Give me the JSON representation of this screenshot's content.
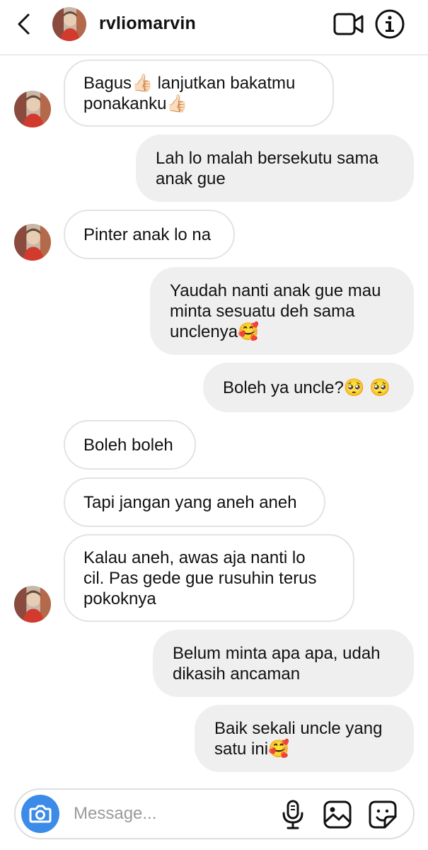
{
  "header": {
    "username": "rvliomarvin",
    "icons": {
      "back": "chevron-left-icon",
      "video": "video-call-icon",
      "info": "info-icon"
    }
  },
  "messages": [
    {
      "direction": "received",
      "text": "Bagus👍🏻 lanjutkan bakatmu\nponakanku👍🏻"
    },
    {
      "direction": "sent",
      "text": "Lah lo malah bersekutu sama\nanak gue"
    },
    {
      "direction": "received",
      "text": "Pinter anak lo na"
    },
    {
      "direction": "sent",
      "text": "Yaudah nanti anak gue mau\nminta sesuatu deh sama\nunclenya🥰"
    },
    {
      "direction": "sent",
      "text": "Boleh ya uncle?🥺 🥺"
    },
    {
      "direction": "received",
      "text": "Boleh boleh"
    },
    {
      "direction": "received",
      "text": "Tapi jangan yang aneh aneh"
    },
    {
      "direction": "received",
      "text": "Kalau aneh, awas aja nanti lo\ncil. Pas gede gue rusuhin terus\npokoknya"
    },
    {
      "direction": "sent",
      "text": "Belum minta apa apa, udah\ndikasih ancaman"
    },
    {
      "direction": "sent",
      "text": "Baik sekali uncle yang\nsatu ini🥰"
    }
  ],
  "composer": {
    "placeholder": "Message...",
    "icons": {
      "camera": "camera-icon",
      "mic": "microphone-icon",
      "gallery": "gallery-icon",
      "sticker": "sticker-icon"
    }
  },
  "colors": {
    "sent_bubble": "#efefef",
    "received_border": "#e3e3e3",
    "camera_button": "#3c8be8",
    "placeholder": "#9a9a9a"
  }
}
